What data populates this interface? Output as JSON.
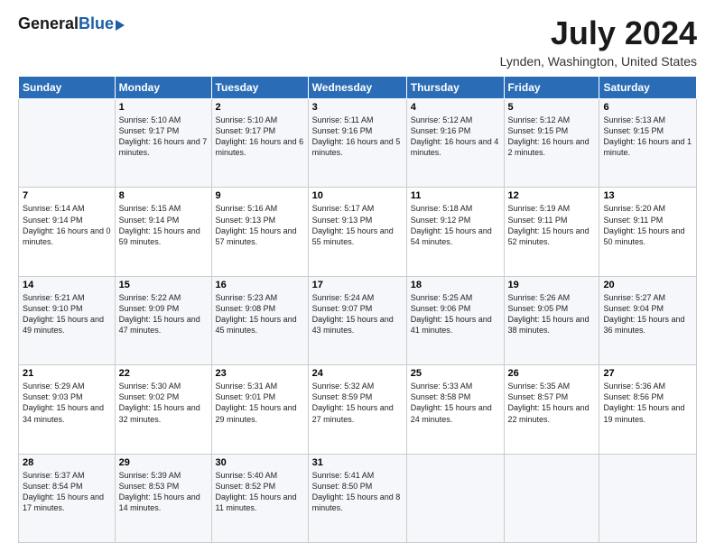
{
  "logo": {
    "general": "General",
    "blue": "Blue"
  },
  "title": "July 2024",
  "location": "Lynden, Washington, United States",
  "headers": [
    "Sunday",
    "Monday",
    "Tuesday",
    "Wednesday",
    "Thursday",
    "Friday",
    "Saturday"
  ],
  "weeks": [
    [
      {
        "day": "",
        "sunrise": "",
        "sunset": "",
        "daylight": ""
      },
      {
        "day": "1",
        "sunrise": "Sunrise: 5:10 AM",
        "sunset": "Sunset: 9:17 PM",
        "daylight": "Daylight: 16 hours and 7 minutes."
      },
      {
        "day": "2",
        "sunrise": "Sunrise: 5:10 AM",
        "sunset": "Sunset: 9:17 PM",
        "daylight": "Daylight: 16 hours and 6 minutes."
      },
      {
        "day": "3",
        "sunrise": "Sunrise: 5:11 AM",
        "sunset": "Sunset: 9:16 PM",
        "daylight": "Daylight: 16 hours and 5 minutes."
      },
      {
        "day": "4",
        "sunrise": "Sunrise: 5:12 AM",
        "sunset": "Sunset: 9:16 PM",
        "daylight": "Daylight: 16 hours and 4 minutes."
      },
      {
        "day": "5",
        "sunrise": "Sunrise: 5:12 AM",
        "sunset": "Sunset: 9:15 PM",
        "daylight": "Daylight: 16 hours and 2 minutes."
      },
      {
        "day": "6",
        "sunrise": "Sunrise: 5:13 AM",
        "sunset": "Sunset: 9:15 PM",
        "daylight": "Daylight: 16 hours and 1 minute."
      }
    ],
    [
      {
        "day": "7",
        "sunrise": "Sunrise: 5:14 AM",
        "sunset": "Sunset: 9:14 PM",
        "daylight": "Daylight: 16 hours and 0 minutes."
      },
      {
        "day": "8",
        "sunrise": "Sunrise: 5:15 AM",
        "sunset": "Sunset: 9:14 PM",
        "daylight": "Daylight: 15 hours and 59 minutes."
      },
      {
        "day": "9",
        "sunrise": "Sunrise: 5:16 AM",
        "sunset": "Sunset: 9:13 PM",
        "daylight": "Daylight: 15 hours and 57 minutes."
      },
      {
        "day": "10",
        "sunrise": "Sunrise: 5:17 AM",
        "sunset": "Sunset: 9:13 PM",
        "daylight": "Daylight: 15 hours and 55 minutes."
      },
      {
        "day": "11",
        "sunrise": "Sunrise: 5:18 AM",
        "sunset": "Sunset: 9:12 PM",
        "daylight": "Daylight: 15 hours and 54 minutes."
      },
      {
        "day": "12",
        "sunrise": "Sunrise: 5:19 AM",
        "sunset": "Sunset: 9:11 PM",
        "daylight": "Daylight: 15 hours and 52 minutes."
      },
      {
        "day": "13",
        "sunrise": "Sunrise: 5:20 AM",
        "sunset": "Sunset: 9:11 PM",
        "daylight": "Daylight: 15 hours and 50 minutes."
      }
    ],
    [
      {
        "day": "14",
        "sunrise": "Sunrise: 5:21 AM",
        "sunset": "Sunset: 9:10 PM",
        "daylight": "Daylight: 15 hours and 49 minutes."
      },
      {
        "day": "15",
        "sunrise": "Sunrise: 5:22 AM",
        "sunset": "Sunset: 9:09 PM",
        "daylight": "Daylight: 15 hours and 47 minutes."
      },
      {
        "day": "16",
        "sunrise": "Sunrise: 5:23 AM",
        "sunset": "Sunset: 9:08 PM",
        "daylight": "Daylight: 15 hours and 45 minutes."
      },
      {
        "day": "17",
        "sunrise": "Sunrise: 5:24 AM",
        "sunset": "Sunset: 9:07 PM",
        "daylight": "Daylight: 15 hours and 43 minutes."
      },
      {
        "day": "18",
        "sunrise": "Sunrise: 5:25 AM",
        "sunset": "Sunset: 9:06 PM",
        "daylight": "Daylight: 15 hours and 41 minutes."
      },
      {
        "day": "19",
        "sunrise": "Sunrise: 5:26 AM",
        "sunset": "Sunset: 9:05 PM",
        "daylight": "Daylight: 15 hours and 38 minutes."
      },
      {
        "day": "20",
        "sunrise": "Sunrise: 5:27 AM",
        "sunset": "Sunset: 9:04 PM",
        "daylight": "Daylight: 15 hours and 36 minutes."
      }
    ],
    [
      {
        "day": "21",
        "sunrise": "Sunrise: 5:29 AM",
        "sunset": "Sunset: 9:03 PM",
        "daylight": "Daylight: 15 hours and 34 minutes."
      },
      {
        "day": "22",
        "sunrise": "Sunrise: 5:30 AM",
        "sunset": "Sunset: 9:02 PM",
        "daylight": "Daylight: 15 hours and 32 minutes."
      },
      {
        "day": "23",
        "sunrise": "Sunrise: 5:31 AM",
        "sunset": "Sunset: 9:01 PM",
        "daylight": "Daylight: 15 hours and 29 minutes."
      },
      {
        "day": "24",
        "sunrise": "Sunrise: 5:32 AM",
        "sunset": "Sunset: 8:59 PM",
        "daylight": "Daylight: 15 hours and 27 minutes."
      },
      {
        "day": "25",
        "sunrise": "Sunrise: 5:33 AM",
        "sunset": "Sunset: 8:58 PM",
        "daylight": "Daylight: 15 hours and 24 minutes."
      },
      {
        "day": "26",
        "sunrise": "Sunrise: 5:35 AM",
        "sunset": "Sunset: 8:57 PM",
        "daylight": "Daylight: 15 hours and 22 minutes."
      },
      {
        "day": "27",
        "sunrise": "Sunrise: 5:36 AM",
        "sunset": "Sunset: 8:56 PM",
        "daylight": "Daylight: 15 hours and 19 minutes."
      }
    ],
    [
      {
        "day": "28",
        "sunrise": "Sunrise: 5:37 AM",
        "sunset": "Sunset: 8:54 PM",
        "daylight": "Daylight: 15 hours and 17 minutes."
      },
      {
        "day": "29",
        "sunrise": "Sunrise: 5:39 AM",
        "sunset": "Sunset: 8:53 PM",
        "daylight": "Daylight: 15 hours and 14 minutes."
      },
      {
        "day": "30",
        "sunrise": "Sunrise: 5:40 AM",
        "sunset": "Sunset: 8:52 PM",
        "daylight": "Daylight: 15 hours and 11 minutes."
      },
      {
        "day": "31",
        "sunrise": "Sunrise: 5:41 AM",
        "sunset": "Sunset: 8:50 PM",
        "daylight": "Daylight: 15 hours and 8 minutes."
      },
      {
        "day": "",
        "sunrise": "",
        "sunset": "",
        "daylight": ""
      },
      {
        "day": "",
        "sunrise": "",
        "sunset": "",
        "daylight": ""
      },
      {
        "day": "",
        "sunrise": "",
        "sunset": "",
        "daylight": ""
      }
    ]
  ]
}
